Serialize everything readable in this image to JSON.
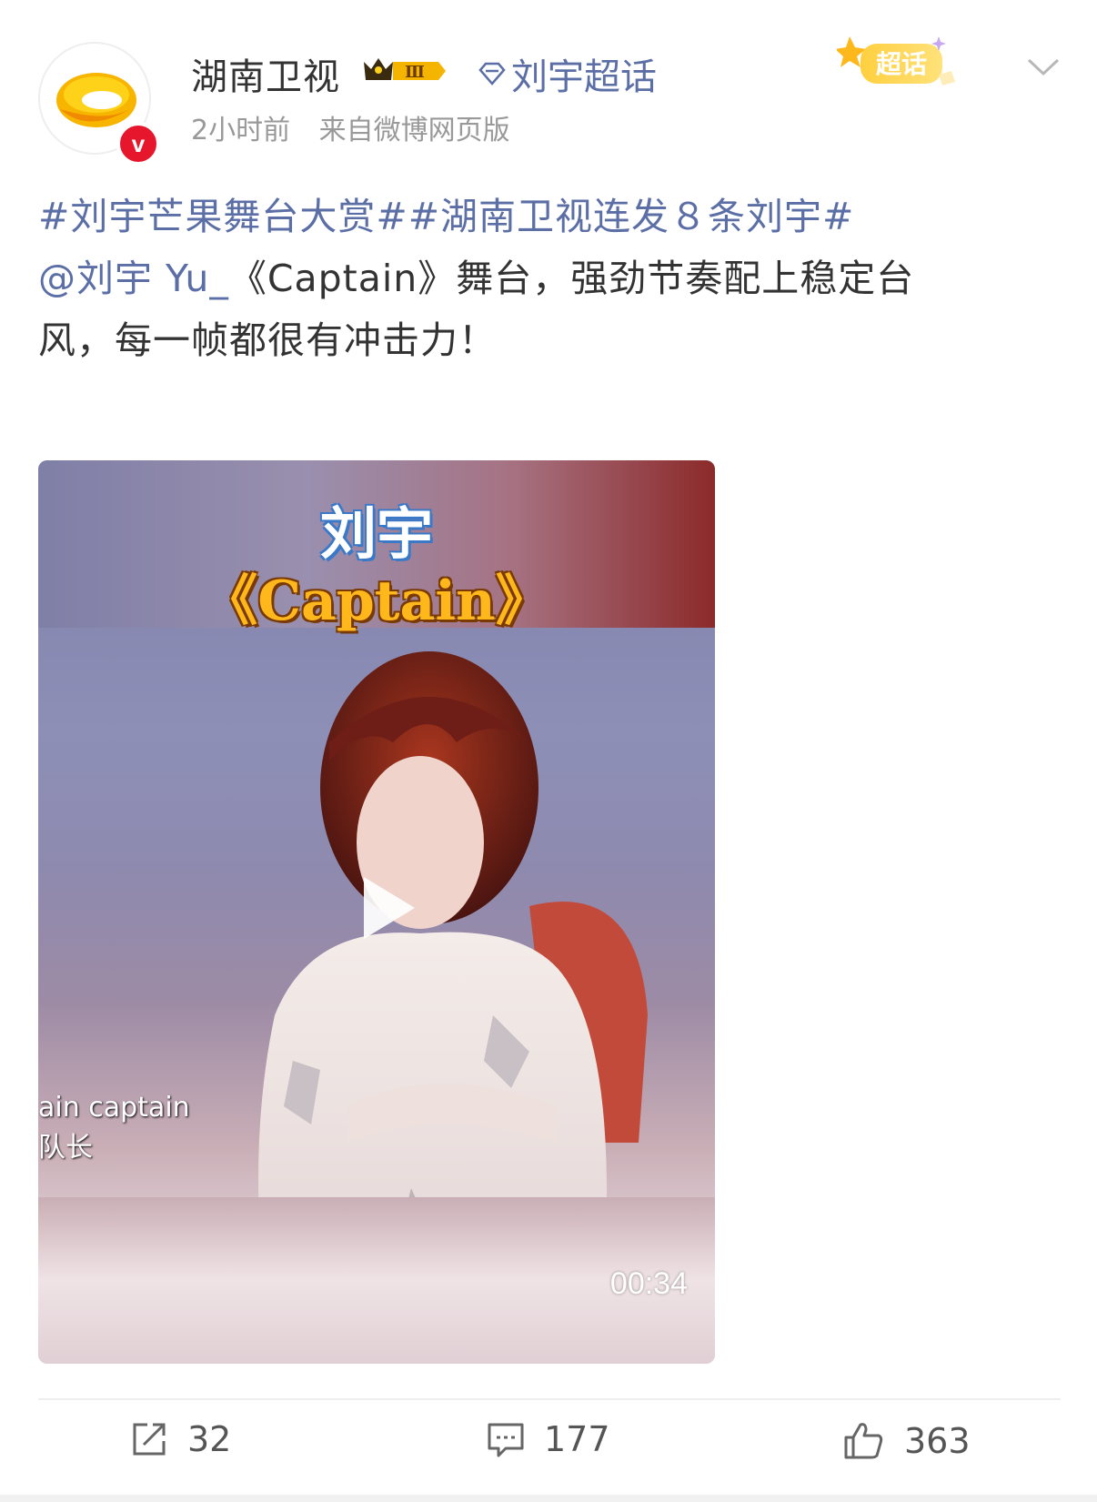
{
  "post": {
    "author": "湖南卫视",
    "level_badge": "Ⅲ",
    "topic_link": "刘宇超话",
    "time": "2小时前",
    "source": "来自微博网页版",
    "chaohua_badge": "超话",
    "text_line1": "#刘宇芒果舞台大赏##湖南卫视连发８条刘宇#",
    "mention": "@刘宇 Yu_",
    "text_line2_rest": "《Captain》舞台，强劲节奏配上稳定台",
    "text_line3": "风，每一帧都很有冲击力！"
  },
  "video": {
    "title": "刘宇",
    "subtitle": "《Captain》",
    "caption_en": "ain captain",
    "caption_zh": "队长",
    "duration": "00:34"
  },
  "actions": {
    "repost_count": "32",
    "comment_count": "177",
    "like_count": "363"
  },
  "colors": {
    "link": "#5b6fa6",
    "verified": "#e6162d",
    "text": "#333333",
    "meta": "#999999"
  }
}
